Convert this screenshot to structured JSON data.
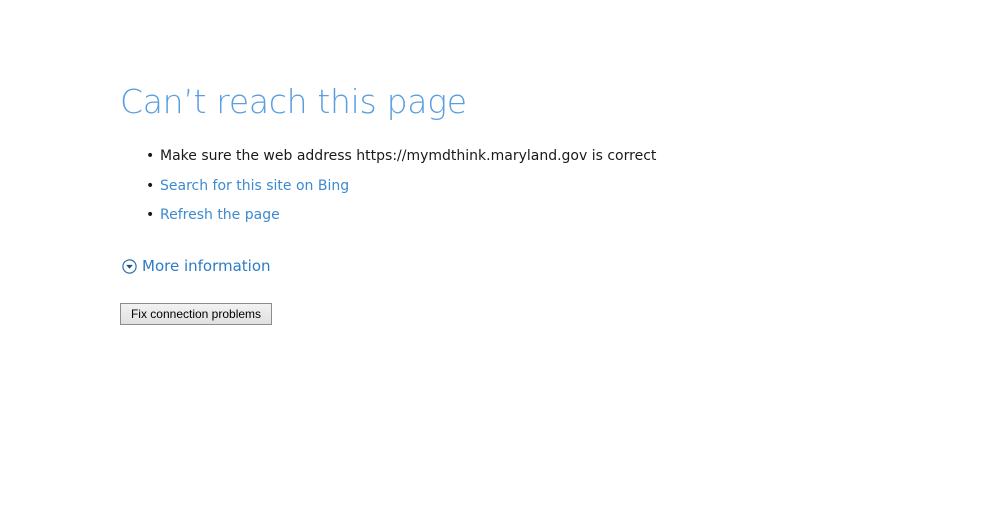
{
  "error": {
    "title": "Can’t reach this page",
    "suggestions": [
      {
        "text": "Make sure the web address https://mymdthink.maryland.gov is correct",
        "is_link": false
      },
      {
        "text": "Search for this site on Bing",
        "is_link": true
      },
      {
        "text": "Refresh the page",
        "is_link": true
      }
    ],
    "more_info_label": "More information",
    "more_info_icon": "chevron-down-circle-icon",
    "fix_button_label": "Fix connection problems"
  },
  "colors": {
    "title": "#5a9ee0",
    "link": "#3d8ad0",
    "text": "#1a1a1a"
  }
}
